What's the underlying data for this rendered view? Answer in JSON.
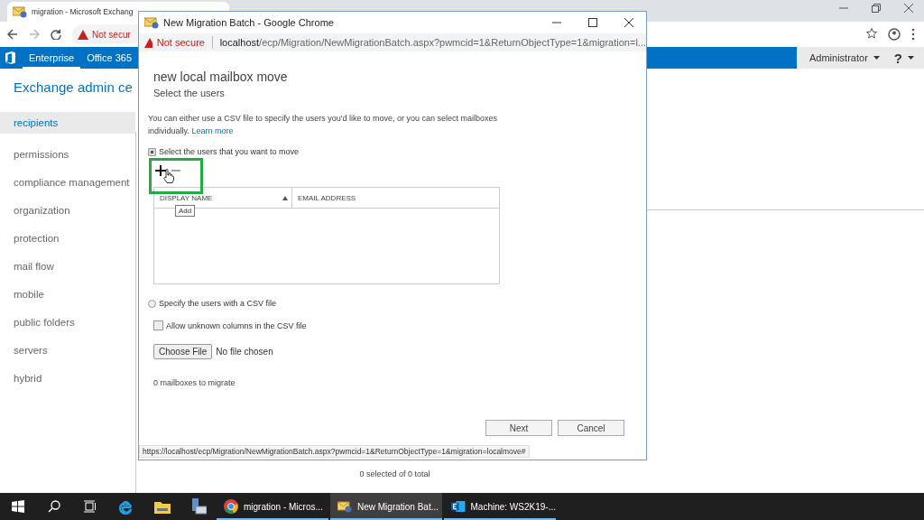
{
  "browser": {
    "tab_title": "migration - Microsoft Exchang",
    "address_warning": "Not secur"
  },
  "nav": {
    "tabs": [
      {
        "label": "Enterprise",
        "selected": true
      },
      {
        "label": "Office 365",
        "selected": false
      }
    ],
    "user": "Administrator",
    "help": "?"
  },
  "admin_title": "Exchange admin ce",
  "sidebar": {
    "items": [
      {
        "label": "recipients",
        "selected": true
      },
      {
        "label": "permissions",
        "selected": false
      },
      {
        "label": "compliance management",
        "selected": false
      },
      {
        "label": "organization",
        "selected": false
      },
      {
        "label": "protection",
        "selected": false
      },
      {
        "label": "mail flow",
        "selected": false
      },
      {
        "label": "mobile",
        "selected": false
      },
      {
        "label": "public folders",
        "selected": false
      },
      {
        "label": "servers",
        "selected": false
      },
      {
        "label": "hybrid",
        "selected": false
      }
    ]
  },
  "list_status": "0 selected of 0 total",
  "dialog": {
    "window_title": "New Migration Batch - Google Chrome",
    "warning": "Not secure",
    "url_host": "localhost",
    "url_path": "/ecp/Migration/NewMigrationBatch.aspx?pwmcid=1&ReturnObjectType=1&migration=l...",
    "heading": "new local mailbox move",
    "subheading": "Select the users",
    "intro": "You can either use a CSV file to specify the users you'd like to move, or you can select mailboxes individually.",
    "learn_more": "Learn more",
    "options": [
      {
        "label": "Select the users that you want to move",
        "selected": true
      },
      {
        "label": "Specify the users with a CSV file",
        "selected": false
      }
    ],
    "columns": [
      {
        "label": "DISPLAY NAME",
        "sorted": true
      },
      {
        "label": "EMAIL ADDRESS",
        "sorted": false
      }
    ],
    "tooltip": "Add",
    "allow_unknown": {
      "label": "Allow unknown columns in the CSV file",
      "checked": false
    },
    "file": {
      "button": "Choose File",
      "status": "No file chosen"
    },
    "count": "0 mailboxes to migrate",
    "buttons": [
      "Next",
      "Cancel"
    ],
    "status_url": "https://localhost/ecp/Migration/NewMigrationBatch.aspx?pwmcid=1&ReturnObjectType=1&migration=localmove#"
  },
  "taskbar": {
    "apps": [
      {
        "kind": "chrome",
        "label": "migration - Micros...",
        "selected": false
      },
      {
        "kind": "mail",
        "label": "New Migration Bat...",
        "selected": true
      },
      {
        "kind": "exchange",
        "label": "Machine: WS2K19-...",
        "selected": false
      }
    ]
  }
}
